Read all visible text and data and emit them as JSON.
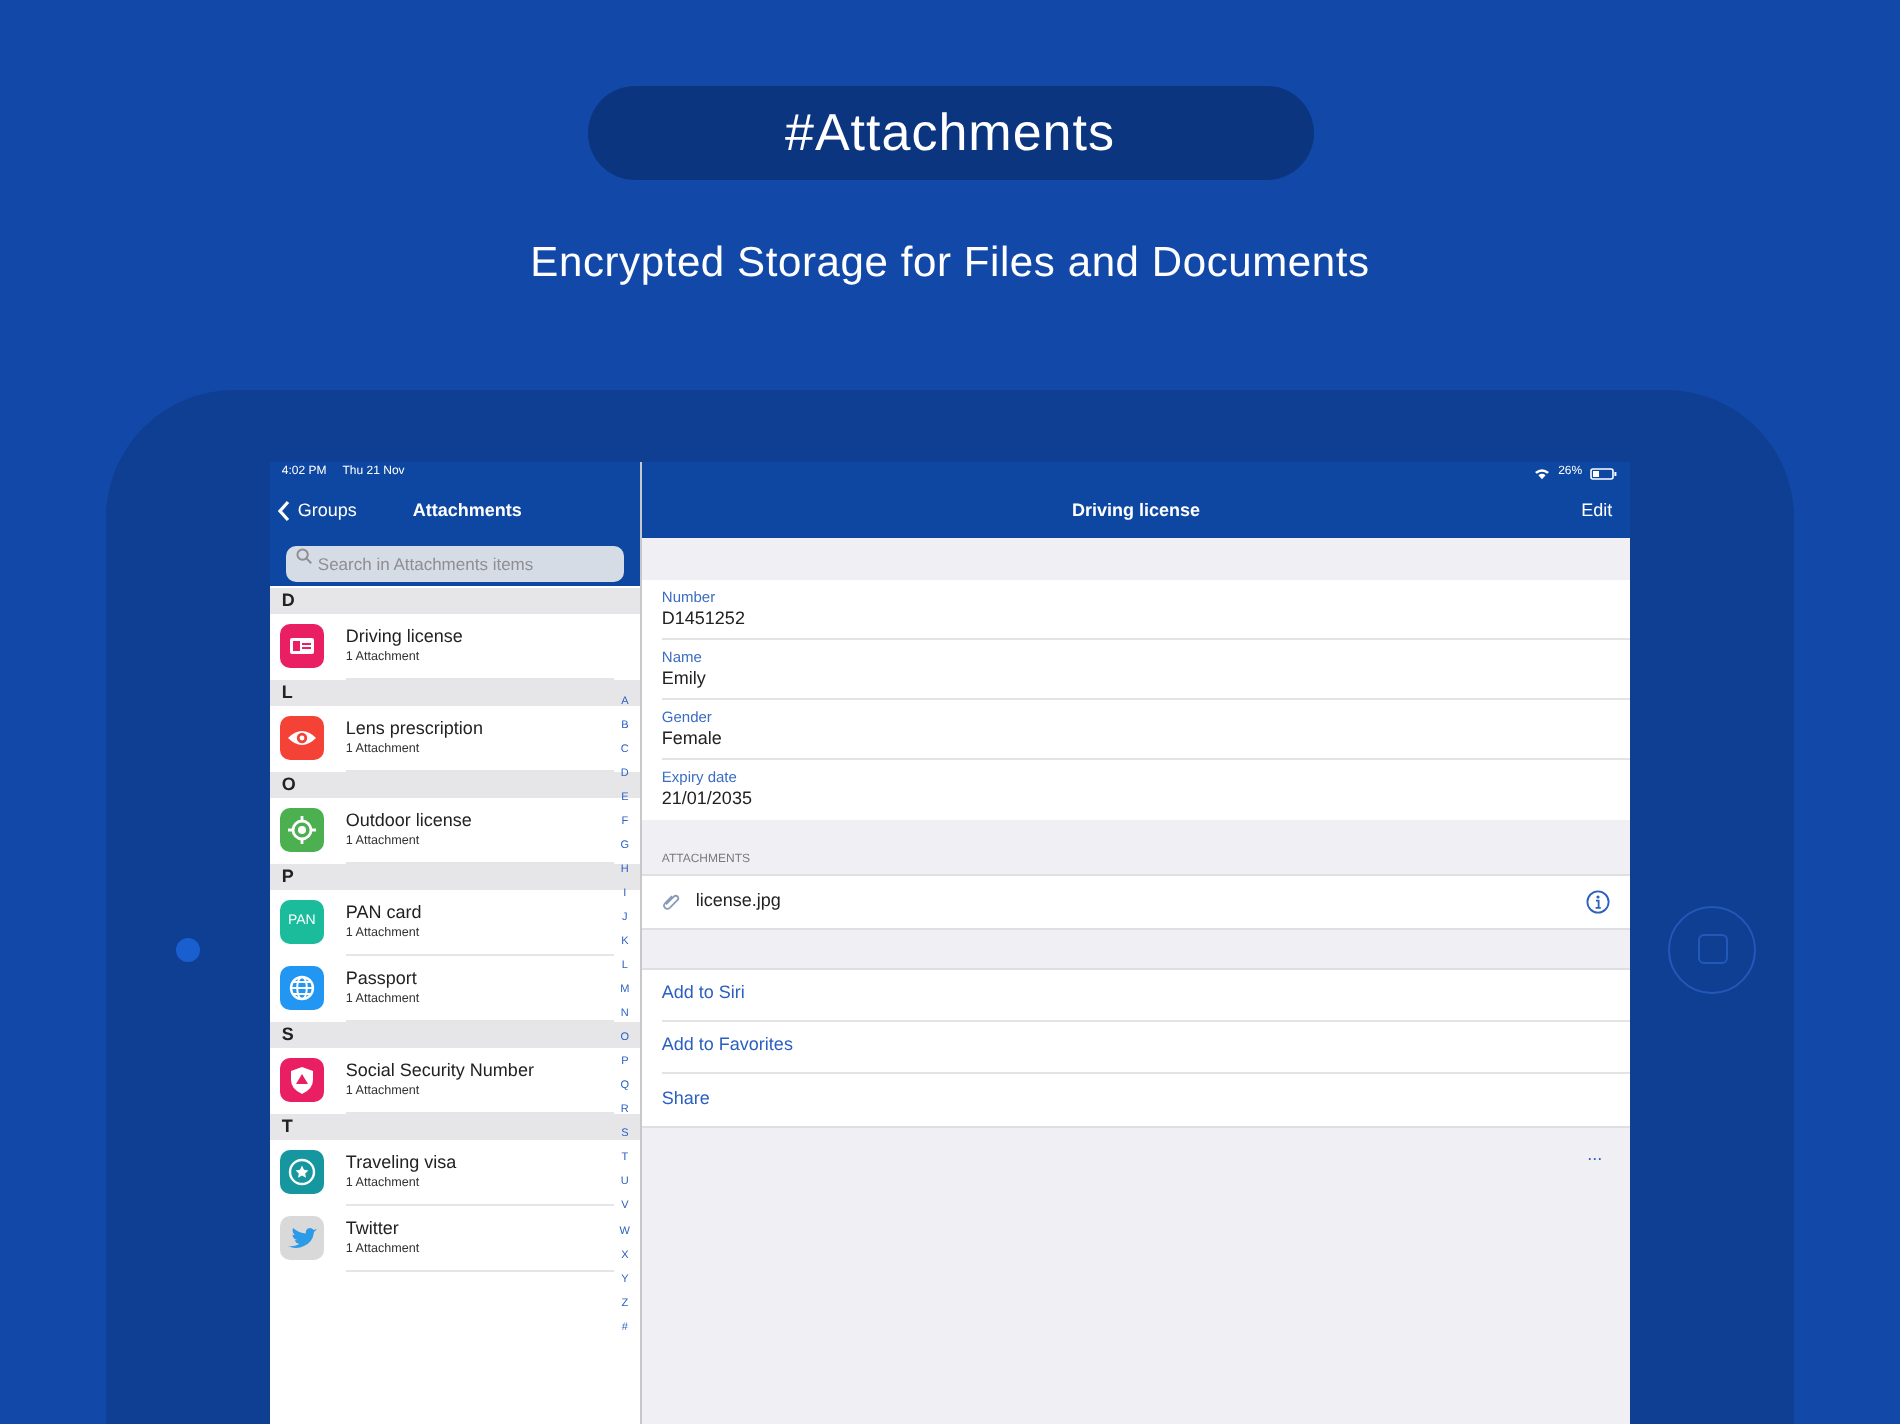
{
  "banner": {
    "hashtag": "#Attachments",
    "subtitle": "Encrypted Storage for Files and Documents"
  },
  "status_bar": {
    "time": "4:02 PM",
    "date": "Thu 21 Nov",
    "battery": "26%"
  },
  "sidebar": {
    "back": "Groups",
    "title": "Attachments",
    "search": {
      "placeholder": "Search in Attachments items"
    },
    "sections": [
      {
        "letter": "D",
        "items": [
          {
            "title": "Driving license",
            "subtitle": "1 Attachment",
            "kind": "card",
            "color": "#e91e63"
          }
        ]
      },
      {
        "letter": "L",
        "items": [
          {
            "title": "Lens prescription",
            "subtitle": "1 Attachment",
            "kind": "eye",
            "color": "#f44336"
          }
        ]
      },
      {
        "letter": "O",
        "items": [
          {
            "title": "Outdoor license",
            "subtitle": "1 Attachment",
            "kind": "target",
            "color": "#4caf50"
          }
        ]
      },
      {
        "letter": "P",
        "items": [
          {
            "title": "PAN card",
            "subtitle": "1 Attachment",
            "kind": "text",
            "icon_text": "PAN",
            "color": "#1abc9c"
          },
          {
            "title": "Passport",
            "subtitle": "1 Attachment",
            "kind": "globe",
            "color": "#2196f3"
          }
        ]
      },
      {
        "letter": "S",
        "items": [
          {
            "title": "Social Security Number",
            "subtitle": "1 Attachment",
            "kind": "shield",
            "color": "#e91e63"
          }
        ]
      },
      {
        "letter": "T",
        "items": [
          {
            "title": "Traveling visa",
            "subtitle": "1 Attachment",
            "kind": "star",
            "color": "#16979f"
          },
          {
            "title": "Twitter",
            "subtitle": "1 Attachment",
            "kind": "bird",
            "color": "#d9d9d9"
          }
        ]
      }
    ],
    "index": [
      "A",
      "B",
      "C",
      "D",
      "E",
      "F",
      "G",
      "H",
      "I",
      "J",
      "K",
      "L",
      "M",
      "N",
      "O",
      "P",
      "Q",
      "R",
      "S",
      "T",
      "U",
      "V",
      "W",
      "X",
      "Y",
      "Z",
      "#"
    ]
  },
  "detail": {
    "title": "Driving license",
    "edit": "Edit",
    "fields": [
      {
        "label": "Number",
        "value": "D1451252"
      },
      {
        "label": "Name",
        "value": "Emily"
      },
      {
        "label": "Gender",
        "value": "Female"
      },
      {
        "label": "Expiry date",
        "value": "21/01/2035"
      }
    ],
    "attachments_header": "ATTACHMENTS",
    "attachments": [
      {
        "name": "license.jpg"
      }
    ],
    "actions": [
      "Add to Siri",
      "Add to Favorites",
      "Share"
    ],
    "more": "..."
  }
}
